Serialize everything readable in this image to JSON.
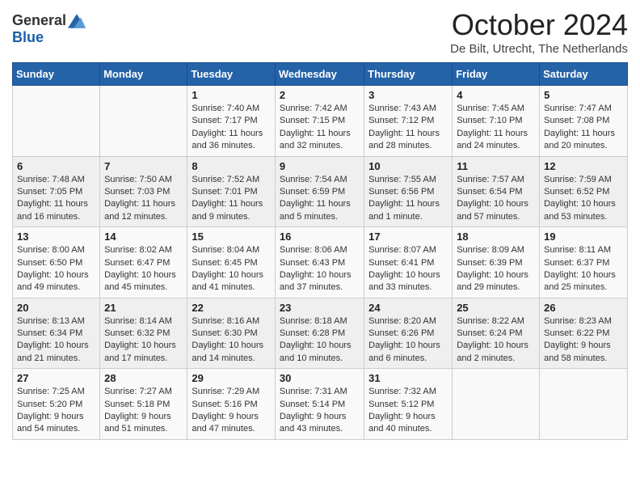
{
  "header": {
    "logo_general": "General",
    "logo_blue": "Blue",
    "month_title": "October 2024",
    "location": "De Bilt, Utrecht, The Netherlands"
  },
  "weekdays": [
    "Sunday",
    "Monday",
    "Tuesday",
    "Wednesday",
    "Thursday",
    "Friday",
    "Saturday"
  ],
  "weeks": [
    [
      {
        "day": "",
        "info": ""
      },
      {
        "day": "",
        "info": ""
      },
      {
        "day": "1",
        "info": "Sunrise: 7:40 AM\nSunset: 7:17 PM\nDaylight: 11 hours and 36 minutes."
      },
      {
        "day": "2",
        "info": "Sunrise: 7:42 AM\nSunset: 7:15 PM\nDaylight: 11 hours and 32 minutes."
      },
      {
        "day": "3",
        "info": "Sunrise: 7:43 AM\nSunset: 7:12 PM\nDaylight: 11 hours and 28 minutes."
      },
      {
        "day": "4",
        "info": "Sunrise: 7:45 AM\nSunset: 7:10 PM\nDaylight: 11 hours and 24 minutes."
      },
      {
        "day": "5",
        "info": "Sunrise: 7:47 AM\nSunset: 7:08 PM\nDaylight: 11 hours and 20 minutes."
      }
    ],
    [
      {
        "day": "6",
        "info": "Sunrise: 7:48 AM\nSunset: 7:05 PM\nDaylight: 11 hours and 16 minutes."
      },
      {
        "day": "7",
        "info": "Sunrise: 7:50 AM\nSunset: 7:03 PM\nDaylight: 11 hours and 12 minutes."
      },
      {
        "day": "8",
        "info": "Sunrise: 7:52 AM\nSunset: 7:01 PM\nDaylight: 11 hours and 9 minutes."
      },
      {
        "day": "9",
        "info": "Sunrise: 7:54 AM\nSunset: 6:59 PM\nDaylight: 11 hours and 5 minutes."
      },
      {
        "day": "10",
        "info": "Sunrise: 7:55 AM\nSunset: 6:56 PM\nDaylight: 11 hours and 1 minute."
      },
      {
        "day": "11",
        "info": "Sunrise: 7:57 AM\nSunset: 6:54 PM\nDaylight: 10 hours and 57 minutes."
      },
      {
        "day": "12",
        "info": "Sunrise: 7:59 AM\nSunset: 6:52 PM\nDaylight: 10 hours and 53 minutes."
      }
    ],
    [
      {
        "day": "13",
        "info": "Sunrise: 8:00 AM\nSunset: 6:50 PM\nDaylight: 10 hours and 49 minutes."
      },
      {
        "day": "14",
        "info": "Sunrise: 8:02 AM\nSunset: 6:47 PM\nDaylight: 10 hours and 45 minutes."
      },
      {
        "day": "15",
        "info": "Sunrise: 8:04 AM\nSunset: 6:45 PM\nDaylight: 10 hours and 41 minutes."
      },
      {
        "day": "16",
        "info": "Sunrise: 8:06 AM\nSunset: 6:43 PM\nDaylight: 10 hours and 37 minutes."
      },
      {
        "day": "17",
        "info": "Sunrise: 8:07 AM\nSunset: 6:41 PM\nDaylight: 10 hours and 33 minutes."
      },
      {
        "day": "18",
        "info": "Sunrise: 8:09 AM\nSunset: 6:39 PM\nDaylight: 10 hours and 29 minutes."
      },
      {
        "day": "19",
        "info": "Sunrise: 8:11 AM\nSunset: 6:37 PM\nDaylight: 10 hours and 25 minutes."
      }
    ],
    [
      {
        "day": "20",
        "info": "Sunrise: 8:13 AM\nSunset: 6:34 PM\nDaylight: 10 hours and 21 minutes."
      },
      {
        "day": "21",
        "info": "Sunrise: 8:14 AM\nSunset: 6:32 PM\nDaylight: 10 hours and 17 minutes."
      },
      {
        "day": "22",
        "info": "Sunrise: 8:16 AM\nSunset: 6:30 PM\nDaylight: 10 hours and 14 minutes."
      },
      {
        "day": "23",
        "info": "Sunrise: 8:18 AM\nSunset: 6:28 PM\nDaylight: 10 hours and 10 minutes."
      },
      {
        "day": "24",
        "info": "Sunrise: 8:20 AM\nSunset: 6:26 PM\nDaylight: 10 hours and 6 minutes."
      },
      {
        "day": "25",
        "info": "Sunrise: 8:22 AM\nSunset: 6:24 PM\nDaylight: 10 hours and 2 minutes."
      },
      {
        "day": "26",
        "info": "Sunrise: 8:23 AM\nSunset: 6:22 PM\nDaylight: 9 hours and 58 minutes."
      }
    ],
    [
      {
        "day": "27",
        "info": "Sunrise: 7:25 AM\nSunset: 5:20 PM\nDaylight: 9 hours and 54 minutes."
      },
      {
        "day": "28",
        "info": "Sunrise: 7:27 AM\nSunset: 5:18 PM\nDaylight: 9 hours and 51 minutes."
      },
      {
        "day": "29",
        "info": "Sunrise: 7:29 AM\nSunset: 5:16 PM\nDaylight: 9 hours and 47 minutes."
      },
      {
        "day": "30",
        "info": "Sunrise: 7:31 AM\nSunset: 5:14 PM\nDaylight: 9 hours and 43 minutes."
      },
      {
        "day": "31",
        "info": "Sunrise: 7:32 AM\nSunset: 5:12 PM\nDaylight: 9 hours and 40 minutes."
      },
      {
        "day": "",
        "info": ""
      },
      {
        "day": "",
        "info": ""
      }
    ]
  ]
}
